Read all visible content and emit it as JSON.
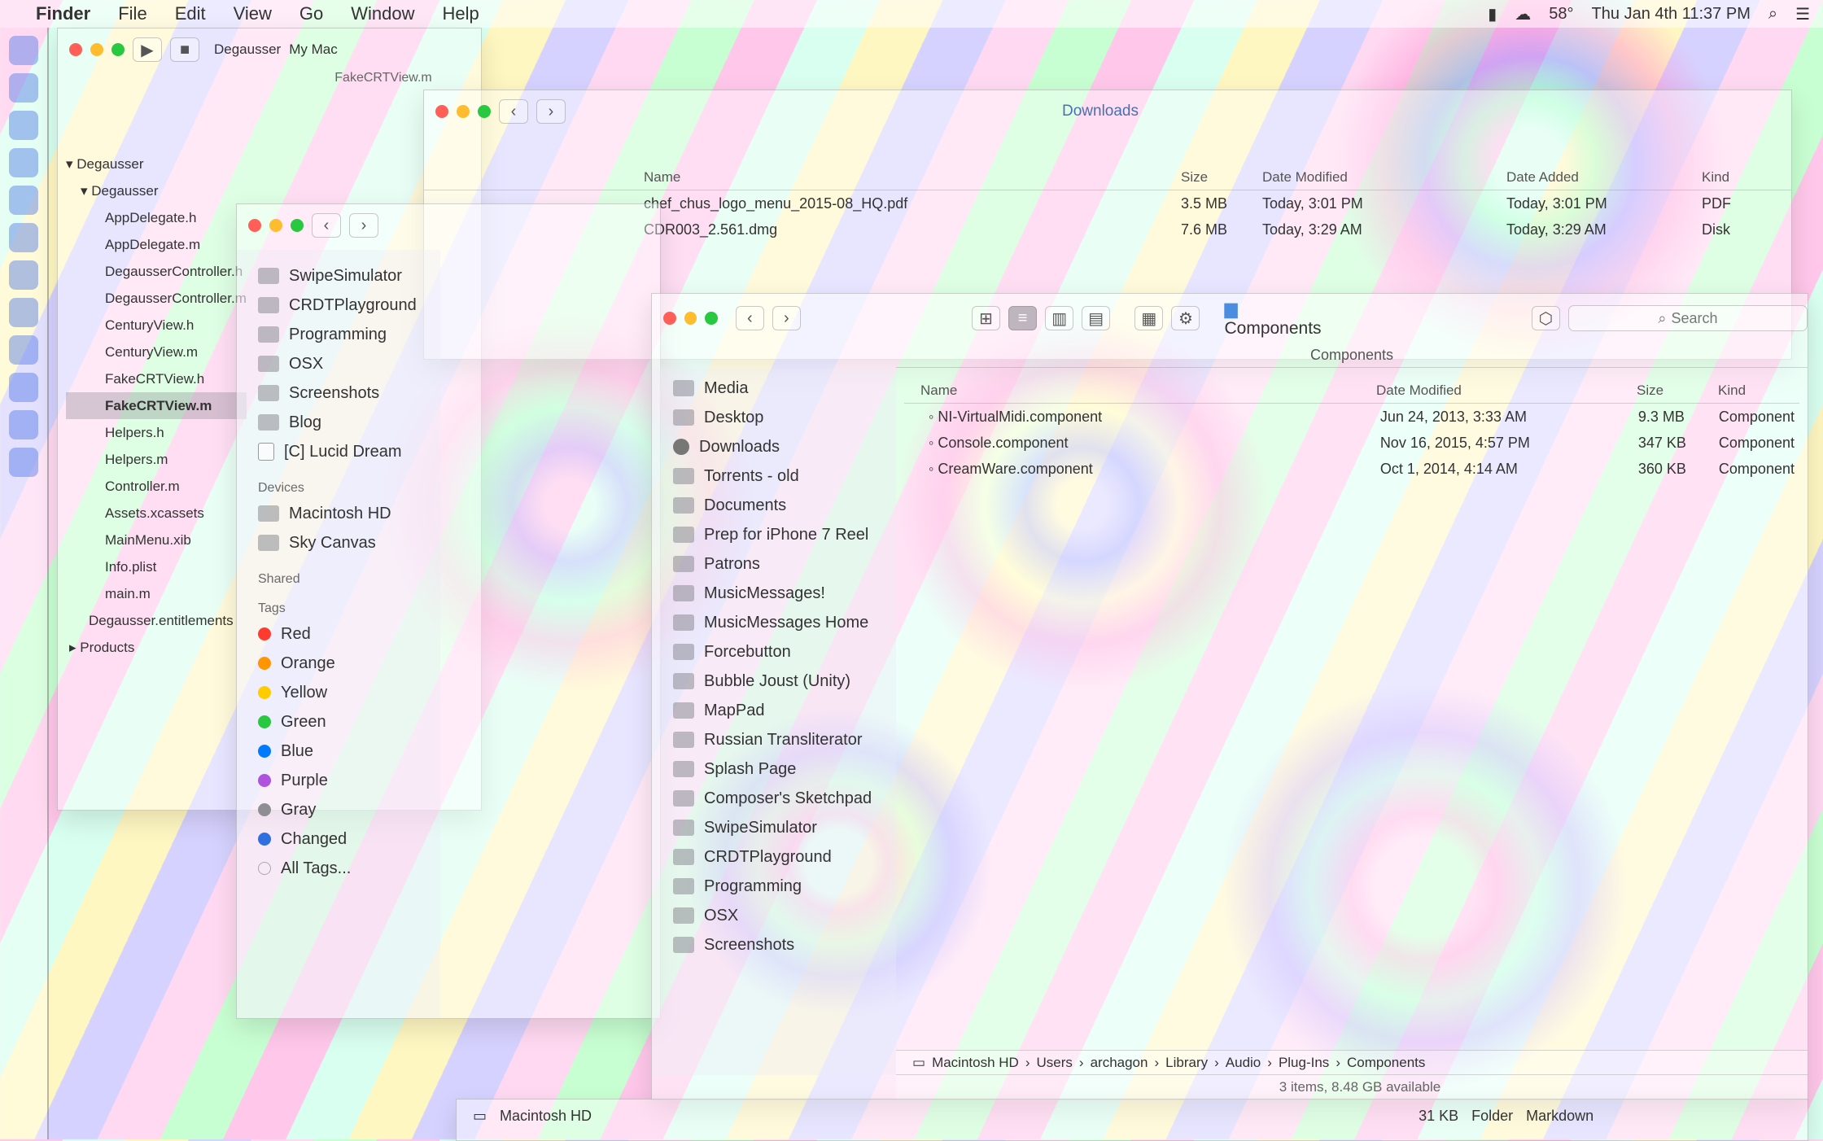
{
  "menubar": {
    "app": "Finder",
    "menus": [
      "File",
      "Edit",
      "View",
      "Go",
      "Window",
      "Help"
    ],
    "temp": "58°",
    "clock": "Thu Jan 4th  11:37 PM"
  },
  "xcode": {
    "tabs": [
      "Degausser",
      "My Mac"
    ],
    "title": "FakeCRTView.m",
    "files": [
      "Degausser",
      "Degausser",
      "AppDelegate.h",
      "AppDelegate.m",
      "DegausserController.h",
      "DegausserController.m",
      "CenturyView.h",
      "CenturyView.m",
      "FakeCRTView.h",
      "FakeCRTView.m",
      "Helpers.h",
      "Helpers.m",
      "Controller.m",
      "Assets.xcassets",
      "MainMenu.xib",
      "Info.plist",
      "main.m",
      "Degausser.entitlements",
      "Products"
    ]
  },
  "back_window": {
    "title": "Downloads",
    "files": [
      "chef_chus_logo_menu_2015-08_HQ.pdf",
      "CDR003_2.561.dmg"
    ],
    "col_size": "Size",
    "col_modified": "Date Modified",
    "col_added": "Date Added",
    "col_kind": "Kind",
    "sizes": [
      "3.5 MB",
      "7.6 MB"
    ],
    "modified": [
      "Today, 3:01 PM",
      "Today, 3:29 AM"
    ],
    "added": [
      "Today, 3:01 PM",
      "Today, 3:29 AM"
    ],
    "kinds": [
      "PDF",
      "Disk"
    ]
  },
  "mid_window": {
    "sidebar": [
      "SwipeSimulator",
      "CRDTPlayground",
      "Programming",
      "OSX",
      "Screenshots",
      "Blog",
      "[C] Lucid Dream"
    ],
    "devices_head": "Devices",
    "devices": [
      "Macintosh HD",
      "Sky Canvas"
    ],
    "shared_head": "Shared",
    "tags_head": "Tags",
    "tags": [
      {
        "name": "Red",
        "color": "#ff3b30"
      },
      {
        "name": "Orange",
        "color": "#ff9500"
      },
      {
        "name": "Yellow",
        "color": "#ffcc00"
      },
      {
        "name": "Green",
        "color": "#28c840"
      },
      {
        "name": "Blue",
        "color": "#007aff"
      },
      {
        "name": "Purple",
        "color": "#af52de"
      },
      {
        "name": "Gray",
        "color": "#8e8e93"
      },
      {
        "name": "Changed",
        "color": "#2f6fe0"
      },
      {
        "name": "All Tags...",
        "color": ""
      }
    ]
  },
  "front_window": {
    "title": "Components",
    "path_title": "Components",
    "search_placeholder": "Search",
    "sidebar": [
      "Media",
      "Desktop",
      "Downloads",
      "Torrents - old",
      "Documents",
      "Prep for iPhone 7 Reel",
      "Patrons",
      "MusicMessages!",
      "MusicMessages Home",
      "Forcebutton",
      "Bubble Joust (Unity)",
      "MapPad",
      "Russian Transliterator",
      "Splash Page",
      "Composer's Sketchpad",
      "SwipeSimulator",
      "CRDTPlayground",
      "Programming",
      "OSX",
      "Screenshots"
    ],
    "col_name": "Name",
    "col_modified": "Date Modified",
    "col_size": "Size",
    "col_kind": "Kind",
    "rows": [
      {
        "name": "NI-VirtualMidi.component",
        "modified": "Jun 24, 2013, 3:33 AM",
        "size": "9.3 MB",
        "kind": "Component"
      },
      {
        "name": "Console.component",
        "modified": "Nov 16, 2015, 4:57 PM",
        "size": "347 KB",
        "kind": "Component"
      },
      {
        "name": "CreamWare.component",
        "modified": "Oct 1, 2014, 4:14 AM",
        "size": "360 KB",
        "kind": "Component"
      }
    ],
    "path": [
      "Macintosh HD",
      "Users",
      "archagon",
      "Library",
      "Audio",
      "Plug-Ins",
      "Components"
    ],
    "status": "3 items, 8.48 GB available"
  },
  "bottom_window": {
    "path": "Macintosh HD",
    "size": "31 KB",
    "kind": "Folder",
    "kind2": "Markdown"
  }
}
